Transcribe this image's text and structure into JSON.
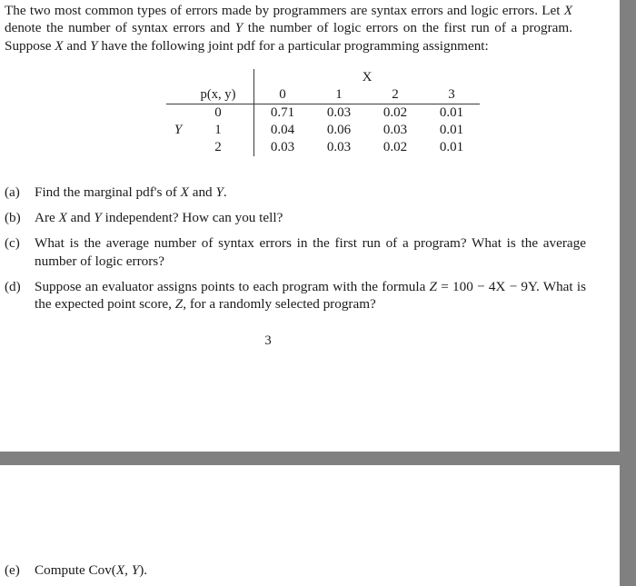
{
  "document": {
    "page_number": "3",
    "separator_color": "#808080",
    "page_background": "#ffffff",
    "text_color": "#1a1a1a"
  },
  "intro": {
    "paragraph": "The two most common types of errors made by programmers are syntax errors and logic errors. Let X denote the number of syntax errors and Y the number of logic errors on the first run of a program. Suppose X and Y have the following joint pdf for a particular programming assignment:"
  },
  "table": {
    "corner_label": "p(x, y)",
    "column_group_label": "X",
    "row_group_label": "Y",
    "column_headers": [
      "0",
      "1",
      "2",
      "3"
    ],
    "row_headers": [
      "0",
      "1",
      "2"
    ],
    "rows": [
      [
        "0.71",
        "0.03",
        "0.02",
        "0.01"
      ],
      [
        "0.04",
        "0.06",
        "0.03",
        "0.01"
      ],
      [
        "0.03",
        "0.03",
        "0.02",
        "0.01"
      ]
    ]
  },
  "questions": [
    {
      "marker": "(a)",
      "text": "Find the marginal pdf's of X and Y."
    },
    {
      "marker": "(b)",
      "text": "Are X and Y independent? How can you tell?"
    },
    {
      "marker": "(c)",
      "text": "What is the average number of syntax errors in the first run of a program? What is the average number of logic errors?"
    },
    {
      "marker": "(d)",
      "text": "Suppose an evaluator assigns points to each program with the formula Z = 100 − 4X − 9Y. What is the expected point score, Z, for a randomly selected program?"
    }
  ],
  "bottom_question": {
    "marker": "(e)",
    "text": "Compute Cov(X, Y)."
  }
}
